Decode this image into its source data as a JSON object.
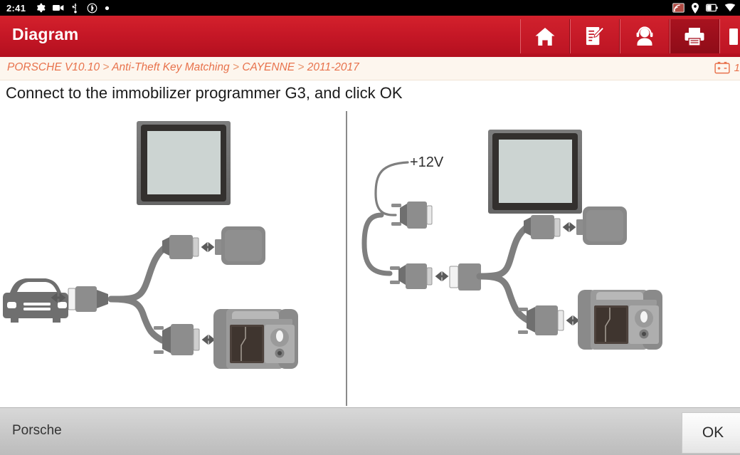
{
  "status_bar": {
    "time": "2:41",
    "left_icons": [
      "gear-icon",
      "video-camera-icon",
      "usb-icon",
      "bluetooth-icon",
      "dot-icon"
    ],
    "right_icons": [
      "cast-screen-icon",
      "location-pin-icon",
      "battery-icon",
      "wifi-icon"
    ]
  },
  "header": {
    "title": "Diagram",
    "toolbar": [
      {
        "name": "home-button",
        "icon": "home-icon",
        "active": false
      },
      {
        "name": "notes-button",
        "icon": "edit-note-icon",
        "active": false
      },
      {
        "name": "support-button",
        "icon": "headset-person-icon",
        "active": false
      },
      {
        "name": "print-button",
        "icon": "printer-icon",
        "active": true
      },
      {
        "name": "exit-button",
        "icon": "exit-icon",
        "active": false
      }
    ]
  },
  "breadcrumb": {
    "parts": [
      "PORSCHE V10.10",
      "Anti-Theft Key Matching",
      "CAYENNE",
      "2011-2017"
    ],
    "separator": ">",
    "voltage_icon": "battery-voltage-icon",
    "voltage_text": "1"
  },
  "instruction": "Connect to the immobilizer programmer G3, and click OK",
  "diagram": {
    "left_panel": {
      "name": "connection-diagram-vehicle",
      "nodes": [
        "display-tablet",
        "car",
        "obd-connector",
        "vci-dongle",
        "immobilizer-programmer-g3"
      ],
      "label": ""
    },
    "right_panel": {
      "name": "connection-diagram-bench",
      "nodes": [
        "display-tablet",
        "power-supply",
        "db-connector",
        "main-connector",
        "vci-dongle",
        "immobilizer-programmer-g3"
      ],
      "label": "+12V"
    }
  },
  "footer": {
    "vehicle_label": "Porsche",
    "ok_label": "OK"
  },
  "colors": {
    "header_red": "#c51726",
    "breadcrumb_orange": "#e8724c",
    "device_gray": "#8d8d8d",
    "device_dark": "#33302e",
    "screen_gray": "#ccd4d2",
    "footer_gray": "#c8c8c8"
  }
}
